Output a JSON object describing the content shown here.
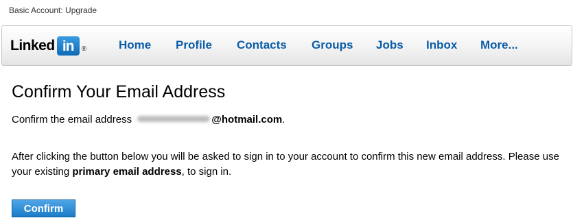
{
  "account_bar": {
    "text": "Basic Account: Upgrade"
  },
  "logo": {
    "text": "Linked",
    "in": "in",
    "registered": "®"
  },
  "nav": {
    "items": [
      {
        "label": "Home"
      },
      {
        "label": "Profile"
      },
      {
        "label": "Contacts"
      },
      {
        "label": "Groups"
      },
      {
        "label": "Jobs"
      },
      {
        "label": "Inbox"
      },
      {
        "label": "More..."
      }
    ]
  },
  "page": {
    "title": "Confirm Your Email Address",
    "line1_prefix": "Confirm the email address",
    "email_domain": "@hotmail.com",
    "line1_suffix": ".",
    "para_part1": "After clicking the button below you will be asked to sign in to your account to confirm this new email address. Please use your existing ",
    "para_bold": "primary email address",
    "para_part2": ", to sign in.",
    "confirm_label": "Confirm"
  },
  "colors": {
    "link_blue": "#0b5ca7",
    "button_blue": "#1a7cc8",
    "logo_blue": "#0e6bb5"
  }
}
